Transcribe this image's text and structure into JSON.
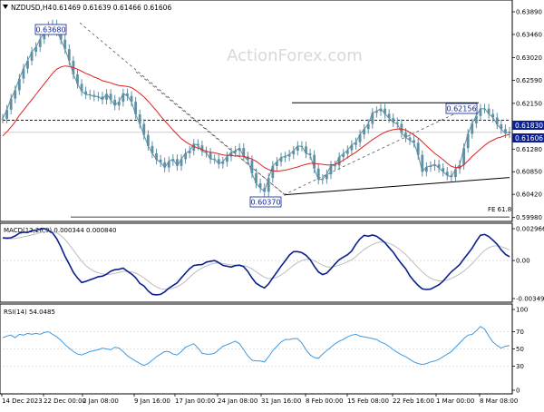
{
  "chart_data": {
    "type": "line",
    "symbol": "NZDUSD,H4",
    "ohlc_header": "0.61469 0.61639 0.61466 0.61606",
    "watermark": "ActionForex.com",
    "x_ticks": [
      "14 Dec 2023",
      "22 Dec 00:00",
      "2 Jan 08:00",
      "9 Jan 16:00",
      "17 Jan 00:00",
      "24 Jan 08:00",
      "31 Jan 16:00",
      "8 Feb 00:00",
      "15 Feb 08:00",
      "22 Feb 16:00",
      "1 Mar 00:00",
      "8 Mar 08:00"
    ],
    "colors": {
      "price": "#5f8fa3",
      "ma": "#e02020",
      "macd": "#0b1f8f",
      "macd_signal": "#bdbdbd",
      "rsi": "#3f9adf",
      "label_bg": "#0b1f8f"
    },
    "price_panel": {
      "y_ticks": [
        "0.63890",
        "0.63460",
        "0.63020",
        "0.62590",
        "0.62150",
        "0.61720",
        "0.61280",
        "0.60850",
        "0.60420",
        "0.59980"
      ],
      "ylim": [
        0.5994,
        0.6408
      ],
      "high_label": "0.63680",
      "low_label": "0.60370",
      "peak_label": "0.62156",
      "level_label": "0.61830",
      "current_label": "0.61606",
      "fe_label": "FE 61.8",
      "fe_value": 0.5999,
      "resistance": 0.6216,
      "dashed_level": 0.6183,
      "close": [
        0.6186,
        0.6203,
        0.6224,
        0.624,
        0.6262,
        0.6281,
        0.6296,
        0.6313,
        0.6322,
        0.6337,
        0.635,
        0.6362,
        0.6365,
        0.6352,
        0.6336,
        0.6318,
        0.6296,
        0.627,
        0.6252,
        0.6238,
        0.6232,
        0.6231,
        0.6228,
        0.6228,
        0.6222,
        0.6233,
        0.6222,
        0.6211,
        0.6218,
        0.6234,
        0.6229,
        0.6218,
        0.6194,
        0.6176,
        0.6155,
        0.6134,
        0.612,
        0.6108,
        0.6103,
        0.6093,
        0.6105,
        0.6109,
        0.6096,
        0.6109,
        0.612,
        0.6125,
        0.6138,
        0.6135,
        0.6124,
        0.6121,
        0.6109,
        0.6109,
        0.61,
        0.6104,
        0.6114,
        0.6122,
        0.6125,
        0.613,
        0.6114,
        0.6107,
        0.6082,
        0.6063,
        0.6054,
        0.6047,
        0.6073,
        0.6096,
        0.6104,
        0.6112,
        0.6114,
        0.6118,
        0.6125,
        0.6134,
        0.6133,
        0.612,
        0.6117,
        0.6091,
        0.607,
        0.6071,
        0.608,
        0.6097,
        0.6097,
        0.6113,
        0.6119,
        0.6126,
        0.6136,
        0.6141,
        0.6156,
        0.6166,
        0.6176,
        0.6197,
        0.62,
        0.6205,
        0.6195,
        0.6187,
        0.6179,
        0.6176,
        0.6159,
        0.615,
        0.6145,
        0.614,
        0.6117,
        0.6085,
        0.6094,
        0.6096,
        0.6099,
        0.6092,
        0.6085,
        0.6078,
        0.6075,
        0.609,
        0.6098,
        0.613,
        0.6157,
        0.6177,
        0.6191,
        0.6205,
        0.6205,
        0.6195,
        0.6188,
        0.6175,
        0.6166,
        0.6158,
        0.6161
      ],
      "ma": [
        0.6153,
        0.6161,
        0.617,
        0.618,
        0.6192,
        0.6202,
        0.6212,
        0.6222,
        0.6232,
        0.6242,
        0.6252,
        0.6262,
        0.6272,
        0.628,
        0.6284,
        0.6286,
        0.6285,
        0.6283,
        0.628,
        0.6276,
        0.6272,
        0.6269,
        0.6265,
        0.6262,
        0.6258,
        0.6256,
        0.6254,
        0.6251,
        0.6249,
        0.6248,
        0.6247,
        0.6245,
        0.624,
        0.6234,
        0.6227,
        0.6219,
        0.621,
        0.6201,
        0.6191,
        0.6182,
        0.6173,
        0.6164,
        0.6156,
        0.6148,
        0.6142,
        0.6137,
        0.6133,
        0.613,
        0.6127,
        0.6124,
        0.6122,
        0.6121,
        0.6119,
        0.6117,
        0.6116,
        0.6116,
        0.6115,
        0.6115,
        0.6114,
        0.6112,
        0.6109,
        0.6105,
        0.6099,
        0.6093,
        0.6089,
        0.6087,
        0.6086,
        0.6087,
        0.6088,
        0.609,
        0.6092,
        0.6094,
        0.6097,
        0.6099,
        0.6101,
        0.6101,
        0.61,
        0.6099,
        0.6098,
        0.6098,
        0.6099,
        0.6102,
        0.6107,
        0.6112,
        0.6117,
        0.6122,
        0.6128,
        0.6134,
        0.614,
        0.6146,
        0.6151,
        0.6156,
        0.616,
        0.6163,
        0.6165,
        0.6166,
        0.6166,
        0.6164,
        0.616,
        0.6155,
        0.6149,
        0.6142,
        0.6134,
        0.6127,
        0.612,
        0.6114,
        0.6108,
        0.6101,
        0.6095,
        0.6093,
        0.6093,
        0.6098,
        0.6106,
        0.6114,
        0.6121,
        0.6128,
        0.6135,
        0.6141,
        0.6145,
        0.6149,
        0.6151,
        0.6154,
        0.6156
      ]
    },
    "macd_panel": {
      "header": "MACD(12,26,9) 0.000344 0.000840",
      "y_ticks": [
        "0.002966",
        "0.00",
        "-0.003494"
      ],
      "ylim": [
        -0.0036,
        0.0032
      ],
      "macd": [
        0.00205,
        0.00202,
        0.00205,
        0.00222,
        0.00246,
        0.00256,
        0.00253,
        0.00271,
        0.00273,
        0.00284,
        0.00289,
        0.00271,
        0.00249,
        0.00196,
        0.00124,
        0.00038,
        -0.00032,
        -0.00107,
        -0.00158,
        -0.00199,
        -0.00189,
        -0.00175,
        -0.00161,
        -0.00146,
        -0.00141,
        -0.00124,
        -0.00097,
        -0.00083,
        -0.00079,
        -0.00069,
        -0.00097,
        -0.00122,
        -0.00154,
        -0.00207,
        -0.0023,
        -0.00275,
        -0.00305,
        -0.0031,
        -0.00306,
        -0.00283,
        -0.00249,
        -0.00226,
        -0.00202,
        -0.00157,
        -0.00114,
        -0.00073,
        -0.00045,
        -0.00039,
        -0.00037,
        -0.00015,
        -7e-05,
        0.0,
        -0.0002,
        -0.00044,
        -0.00052,
        -0.00059,
        -0.00046,
        -0.00042,
        -0.00056,
        -0.00099,
        -0.00158,
        -0.00205,
        -0.0023,
        -0.00248,
        -0.00212,
        -0.00157,
        -0.00105,
        -0.00051,
        -3e-05,
        0.00049,
        0.0008,
        0.0008,
        0.00071,
        0.00047,
        8e-05,
        -0.00051,
        -0.00103,
        -0.00127,
        -0.00113,
        -0.00074,
        -0.00031,
        7e-05,
        0.00031,
        0.00052,
        0.00086,
        0.00146,
        0.00195,
        0.00227,
        0.00219,
        0.0023,
        0.00218,
        0.00191,
        0.00162,
        0.00117,
        0.00075,
        0.0002,
        -0.0003,
        -0.00075,
        -0.00138,
        -0.00185,
        -0.00225,
        -0.00257,
        -0.00262,
        -0.00258,
        -0.00239,
        -0.00219,
        -0.00186,
        -0.00143,
        -0.00101,
        -0.00071,
        -0.00037,
        0.00015,
        0.00062,
        0.00113,
        0.00173,
        0.00228,
        0.00236,
        0.00216,
        0.00183,
        0.00146,
        0.00096,
        0.00056,
        0.00034
      ],
      "signal": [
        0.00198,
        0.00196,
        0.00196,
        0.00199,
        0.00206,
        0.00214,
        0.00222,
        0.00231,
        0.0024,
        0.00251,
        0.0026,
        0.00264,
        0.00262,
        0.0025,
        0.00226,
        0.0019,
        0.00145,
        0.00094,
        0.00043,
        -6e-05,
        -0.00045,
        -0.00075,
        -0.00097,
        -0.00112,
        -0.00122,
        -0.00127,
        -0.00123,
        -0.00116,
        -0.00108,
        -0.00099,
        -0.00097,
        -0.00102,
        -0.00113,
        -0.00133,
        -0.00156,
        -0.00186,
        -0.00216,
        -0.00239,
        -0.00255,
        -0.0026,
        -0.00257,
        -0.0025,
        -0.00237,
        -0.00216,
        -0.00187,
        -0.00151,
        -0.00116,
        -0.00088,
        -0.00067,
        -0.0005,
        -0.00036,
        -0.00023,
        -0.00022,
        -0.00027,
        -0.00033,
        -0.0004,
        -0.00043,
        -0.00043,
        -0.00045,
        -0.00055,
        -0.00076,
        -0.00102,
        -0.00128,
        -0.00152,
        -0.00164,
        -0.00162,
        -0.00151,
        -0.00131,
        -0.00105,
        -0.00074,
        -0.00043,
        -0.00018,
        0.0,
        0.0001,
        0.0001,
        -2e-05,
        -0.00022,
        -0.00043,
        -0.00057,
        -0.0006,
        -0.00054,
        -0.00042,
        -0.00027,
        -0.00011,
        8e-05,
        0.00036,
        0.00068,
        0.001,
        0.00124,
        0.00145,
        0.0016,
        0.00166,
        0.00165,
        0.00155,
        0.00139,
        0.00115,
        0.00086,
        0.00054,
        0.00015,
        -0.00025,
        -0.00065,
        -0.00103,
        -0.00135,
        -0.00159,
        -0.00175,
        -0.00184,
        -0.00184,
        -0.00176,
        -0.00161,
        -0.00143,
        -0.00122,
        -0.00095,
        -0.00063,
        -0.00028,
        0.00012,
        0.00055,
        0.00091,
        0.00116,
        0.00129,
        0.00133,
        0.00125,
        0.00111,
        0.00096
      ]
    },
    "rsi_panel": {
      "header": "RSI(14) 54.0485",
      "y_ticks": [
        "100",
        "70",
        "50",
        "30",
        "0"
      ],
      "ylim": [
        0,
        100
      ],
      "values": [
        63,
        65,
        66,
        63,
        67,
        66,
        68,
        67,
        68,
        67,
        69,
        70,
        67,
        64,
        60,
        55,
        51,
        47,
        44,
        43,
        45,
        47,
        48,
        49,
        51,
        50,
        49,
        52,
        51,
        47,
        42,
        39,
        36,
        33,
        31,
        33,
        37,
        41,
        44,
        47,
        47,
        44,
        43,
        47,
        52,
        54,
        56,
        51,
        45,
        44,
        44,
        45,
        49,
        53,
        55,
        57,
        59,
        56,
        49,
        42,
        37,
        36,
        36,
        35,
        41,
        48,
        53,
        58,
        61,
        61,
        62,
        62,
        57,
        49,
        43,
        40,
        39,
        44,
        48,
        52,
        56,
        59,
        61,
        64,
        66,
        67,
        65,
        64,
        63,
        62,
        61,
        58,
        56,
        53,
        49,
        46,
        43,
        41,
        38,
        35,
        33,
        32,
        33,
        35,
        36,
        38,
        41,
        44,
        47,
        52,
        57,
        62,
        66,
        67,
        71,
        76,
        73,
        65,
        58,
        54,
        51,
        53,
        54
      ]
    }
  }
}
